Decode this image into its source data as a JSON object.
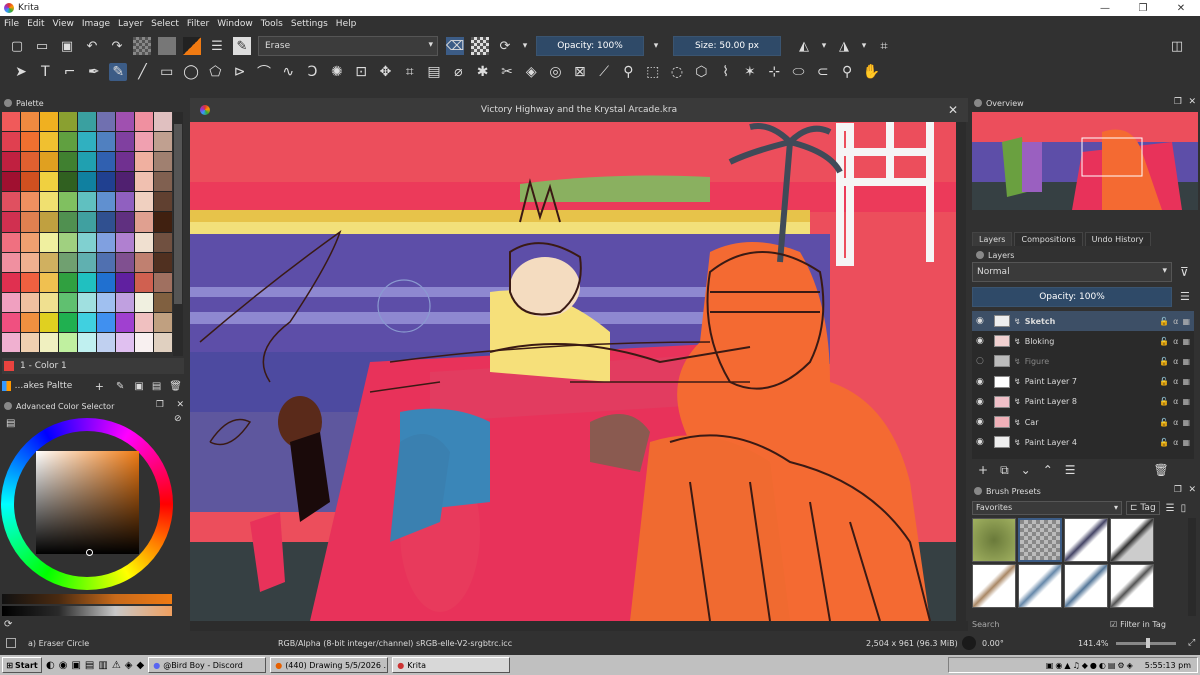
{
  "window": {
    "title": "Krita",
    "minimize": "—",
    "maximize": "❐",
    "close": "✕"
  },
  "menu": [
    "File",
    "Edit",
    "View",
    "Image",
    "Layer",
    "Select",
    "Filter",
    "Window",
    "Tools",
    "Settings",
    "Help"
  ],
  "toolbar": {
    "blend_mode": "Erase",
    "opacity": "Opacity: 100%",
    "size": "Size: 50.00 px"
  },
  "palette": {
    "title": "Palette",
    "current_color": "1 - Color 1",
    "palette_name": "...akes Paltte",
    "colors": [
      "#f05a5a",
      "#f08a40",
      "#f0b020",
      "#8aa030",
      "#3aa0a0",
      "#7070b0",
      "#a050b0",
      "#f090a0",
      "#e0c0c0",
      "#ffffff",
      "#e04050",
      "#f07030",
      "#f0c030",
      "#60a040",
      "#30b0c0",
      "#5080c0",
      "#8040a0",
      "#f0a0b0",
      "#c0a090",
      "#d0d0d0",
      "#c02040",
      "#e06030",
      "#e0a020",
      "#408030",
      "#20a0b0",
      "#3060b0",
      "#703090",
      "#f0b0a0",
      "#a08070",
      "#b0b0b0",
      "#a01030",
      "#d05020",
      "#f0d040",
      "#306020",
      "#1080a0",
      "#204090",
      "#502070",
      "#f0c0b0",
      "#806050",
      "#909090",
      "#e05060",
      "#f09060",
      "#f0e070",
      "#80c060",
      "#60c0c0",
      "#6090d0",
      "#9060c0",
      "#f0d0c0",
      "#604030",
      "#707070",
      "#d03050",
      "#e08050",
      "#c0a040",
      "#509050",
      "#40a0a0",
      "#305090",
      "#603080",
      "#e0a090",
      "#402010",
      "#505050",
      "#f07080",
      "#f0a070",
      "#f0f0a0",
      "#a0d080",
      "#80d0d0",
      "#80a0e0",
      "#b080d0",
      "#f0e0d0",
      "#705040",
      "#404040",
      "#f090a0",
      "#f0b090",
      "#d0b060",
      "#70a070",
      "#60b0b0",
      "#5070b0",
      "#805090",
      "#c08070",
      "#503020",
      "#303030",
      "#e03050",
      "#f06040",
      "#f0c050",
      "#30a040",
      "#20c0c0",
      "#2070d0",
      "#6020a0",
      "#d06050",
      "#a07060",
      "#202020",
      "#f0a0c0",
      "#f0c0a0",
      "#f0e090",
      "#60c070",
      "#a0e0e0",
      "#a0c0f0",
      "#c0a0e0",
      "#f0f0e0",
      "#806040",
      "#101010",
      "#f05080",
      "#f09040",
      "#e0d020",
      "#20b050",
      "#40d0e0",
      "#4090f0",
      "#a040d0",
      "#f0c0c0",
      "#c0a080",
      "#000000",
      "#f0b0d0",
      "#f0d0b0",
      "#f0f0c0",
      "#c0f0a0",
      "#c0f0f0",
      "#c0d0f0",
      "#e0c0f0",
      "#f8f0f0",
      "#e0d0c0",
      "#f8f8f8"
    ]
  },
  "acs": {
    "title": "Advanced Color Selector"
  },
  "document": {
    "title": "Victory Highway and the Krystal Arcade.kra"
  },
  "overview": {
    "title": "Overview"
  },
  "layers": {
    "tabs": [
      "Layers",
      "Compositions",
      "Undo History"
    ],
    "header": "Layers",
    "blend": "Normal",
    "opacity": "Opacity: 100%",
    "items": [
      {
        "name": "Sketch",
        "visible": true,
        "selected": true
      },
      {
        "name": "Bloking",
        "visible": true,
        "selected": false
      },
      {
        "name": "Figure",
        "visible": false,
        "selected": false
      },
      {
        "name": "Paint Layer 7",
        "visible": true,
        "selected": false
      },
      {
        "name": "Paint Layer 8",
        "visible": true,
        "selected": false
      },
      {
        "name": "Car",
        "visible": true,
        "selected": false
      },
      {
        "name": "Paint Layer 4",
        "visible": true,
        "selected": false
      }
    ]
  },
  "brush_presets": {
    "title": "Brush Presets",
    "tag": "Favorites",
    "tag_button": "Tag",
    "search_placeholder": "Search",
    "filter_label": "Filter in Tag"
  },
  "status": {
    "brush": "a) Eraser Circle",
    "colorspace": "RGB/Alpha (8-bit integer/channel)  sRGB-elle-V2-srgbtrc.icc",
    "image_size": "2,504 x 961 (96.3 MiB)",
    "rotation": "0.00°",
    "zoom": "141.4%"
  },
  "taskbar": {
    "start": "Start",
    "tasks": [
      "@Bird Boy - Discord",
      "(440) Drawing 5/5/2026 ...",
      "Krita"
    ],
    "clock": "5:55:13 pm"
  },
  "colors": {
    "accent": "#3c5c86",
    "canvas_bg": "#ec4e5c"
  }
}
